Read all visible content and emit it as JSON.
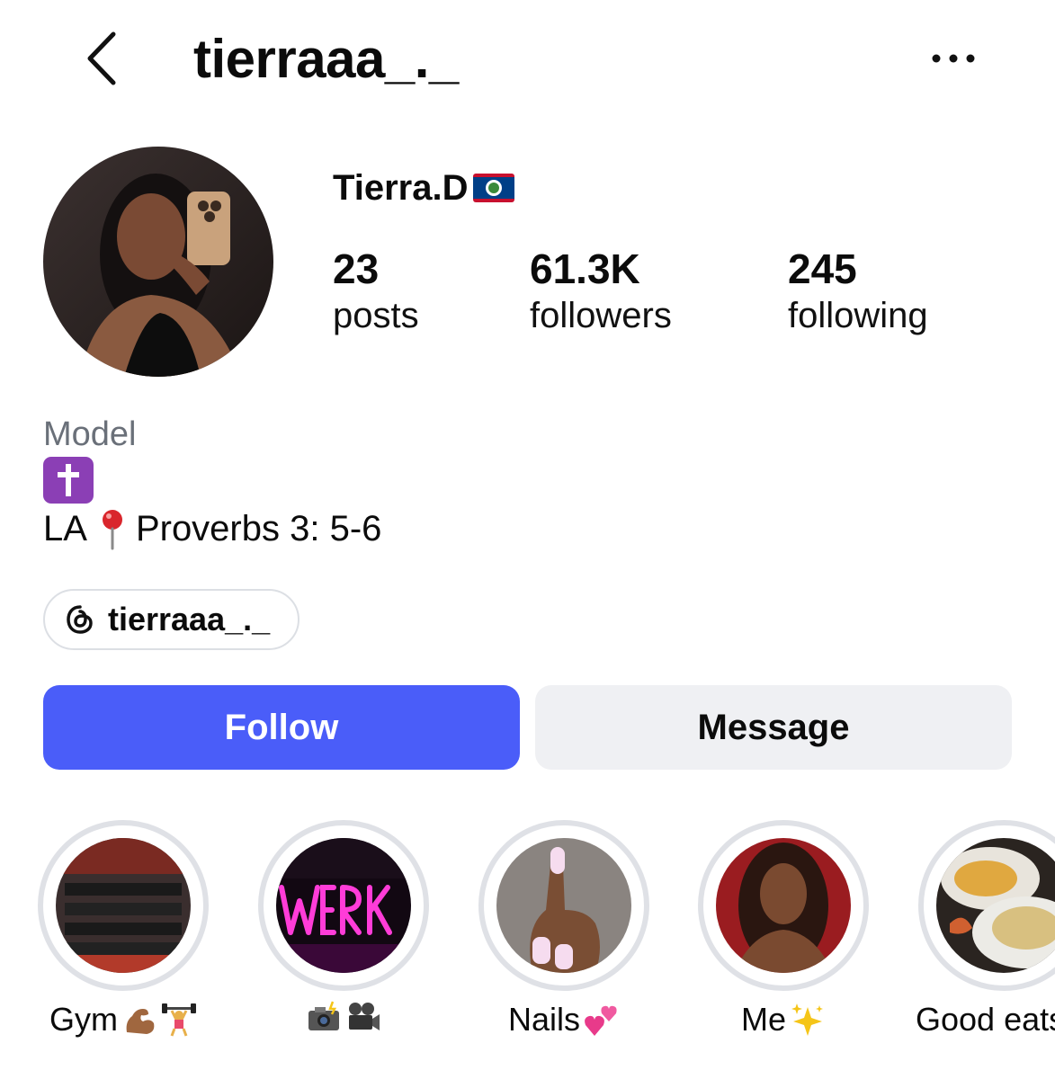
{
  "header": {
    "username": "tierraaa_._",
    "back_icon": "chevron-left-icon",
    "more_icon": "more-horizontal-icon"
  },
  "profile": {
    "display_name": "Tierra.D",
    "flag": "belize-flag-icon",
    "stats": {
      "posts": {
        "value": "23",
        "label": "posts"
      },
      "followers": {
        "value": "61.3K",
        "label": "followers"
      },
      "following": {
        "value": "245",
        "label": "following"
      }
    },
    "bio": {
      "category": "Model",
      "line1_emoji": "latin-cross-emoji",
      "line2_prefix": "LA",
      "line2_emoji": "round-pushpin-emoji",
      "line2_suffix": "Proverbs 3: 5-6"
    },
    "threads_link": {
      "icon": "threads-icon",
      "label": "tierraaa_._"
    }
  },
  "actions": {
    "follow_label": "Follow",
    "message_label": "Message"
  },
  "highlights": [
    {
      "label": "Gym",
      "emojis": [
        "flexed-biceps-emoji",
        "weight-lifter-emoji"
      ]
    },
    {
      "label": "",
      "emojis": [
        "camera-flash-emoji",
        "movie-camera-emoji"
      ]
    },
    {
      "label": "Nails",
      "emojis": [
        "two-hearts-emoji"
      ]
    },
    {
      "label": "Me",
      "emojis": [
        "sparkles-emoji"
      ]
    },
    {
      "label": "Good eats",
      "emojis": []
    }
  ],
  "colors": {
    "follow_button": "#4a5df9",
    "message_button": "#eff0f3",
    "category_text": "#6a7079",
    "highlight_ring": "#dfe1e6"
  }
}
